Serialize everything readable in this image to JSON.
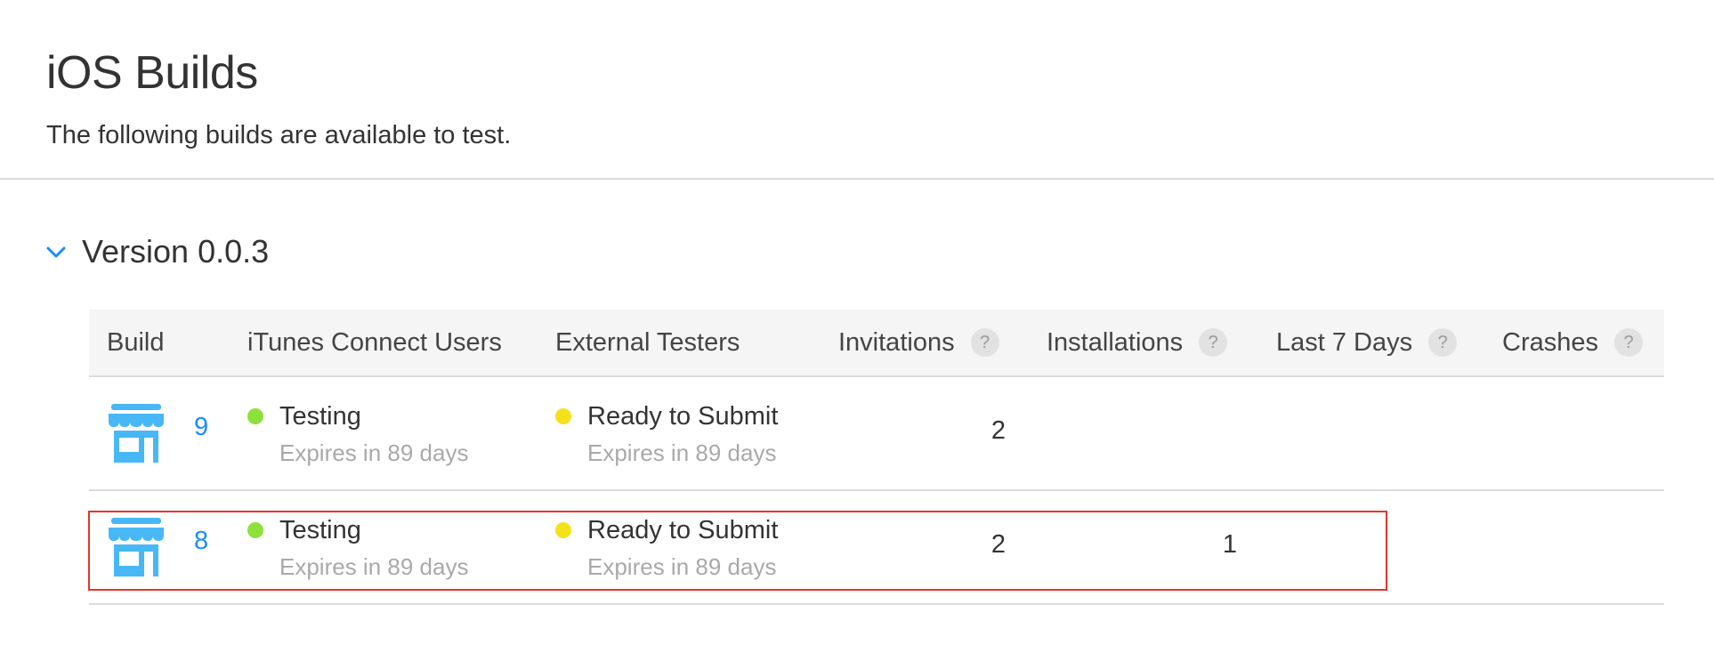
{
  "header": {
    "title": "iOS Builds",
    "subtitle": "The following builds are available to test."
  },
  "version": {
    "label": "Version 0.0.3",
    "expanded": true
  },
  "table": {
    "columns": {
      "build": "Build",
      "itunes_users": "iTunes Connect Users",
      "external_testers": "External Testers",
      "invitations": "Invitations",
      "installations": "Installations",
      "last7": "Last 7 Days",
      "crashes": "Crashes",
      "help_glyph": "?"
    },
    "rows": [
      {
        "build": "9",
        "itunes_status": "Testing",
        "itunes_expiry": "Expires in 89 days",
        "external_status": "Ready to Submit",
        "external_expiry": "Expires in 89 days",
        "invitations": "2",
        "installations": "",
        "last7": "",
        "crashes": ""
      },
      {
        "build": "8",
        "itunes_status": "Testing",
        "itunes_expiry": "Expires in 89 days",
        "external_status": "Ready to Submit",
        "external_expiry": "Expires in 89 days",
        "invitations": "2",
        "installations": "1",
        "last7": "",
        "crashes": ""
      }
    ]
  },
  "colors": {
    "testing": "#8ee03a",
    "ready_to_submit": "#f5e11a",
    "link": "#1a8cff",
    "icon": "#47b8f5",
    "highlight": "#e0362c"
  },
  "icons": {
    "chevron": "chevron-down-icon",
    "build": "storefront-icon",
    "help": "help-icon"
  }
}
